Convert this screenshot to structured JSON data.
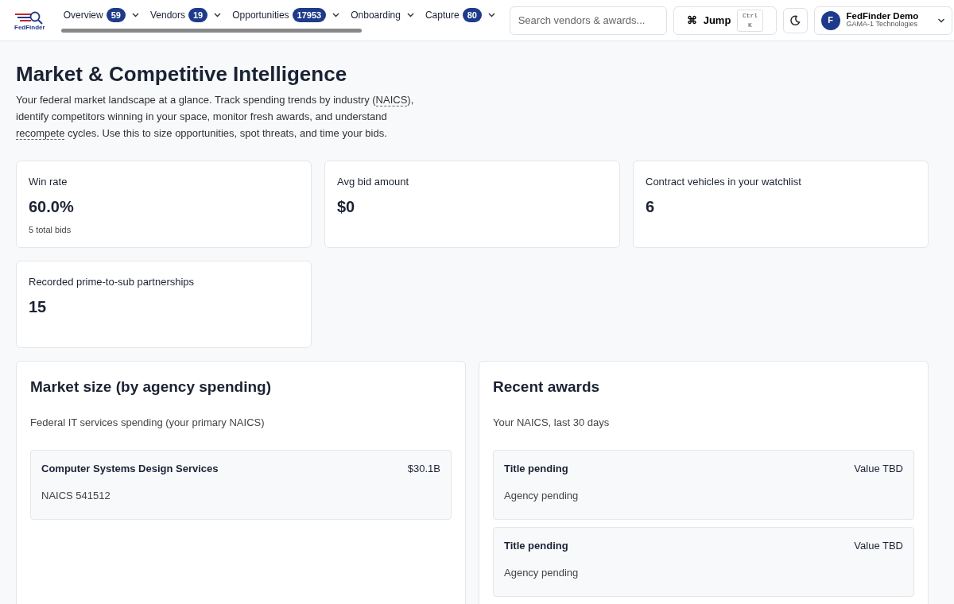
{
  "brand": {
    "name": "FedFinder"
  },
  "nav": [
    {
      "label": "Overview",
      "count": "59"
    },
    {
      "label": "Vendors",
      "count": "19"
    },
    {
      "label": "Opportunities",
      "count": "17953"
    },
    {
      "label": "Onboarding"
    },
    {
      "label": "Capture",
      "count": "80"
    }
  ],
  "search": {
    "placeholder": "Search vendors & awards..."
  },
  "jump": {
    "icon": "⌘",
    "label": "Jump",
    "shortcut": "Ctrl K"
  },
  "user": {
    "initial": "F",
    "name": "FedFinder Demo",
    "org": "GAMA-1 Technologies"
  },
  "page": {
    "title": "Market & Competitive Intelligence",
    "description": [
      {
        "kind": "text",
        "text": "Your federal market landscape at a glance. Track spending trends by industry ("
      },
      {
        "kind": "term",
        "text": "NAICS"
      },
      {
        "kind": "text",
        "text": "), identify competitors winning in your space, monitor fresh awards, and understand "
      },
      {
        "kind": "term",
        "text": "recompete"
      },
      {
        "kind": "text",
        "text": " cycles. Use this to size opportunities, spot threats, and time your bids."
      }
    ]
  },
  "stats": [
    {
      "label": "Win rate",
      "value": "60.0%",
      "note": "5 total bids"
    },
    {
      "label": "Avg bid amount",
      "value": "$0"
    },
    {
      "label": "Contract vehicles in your watchlist",
      "value": "6"
    },
    {
      "label": "Recorded prime-to-sub partnerships",
      "value": "15"
    }
  ],
  "market": {
    "title": "Market size (by agency spending)",
    "subtitle": "Federal IT services spending (your primary NAICS)",
    "items": [
      {
        "name": "Computer Systems Design Services",
        "amount": "$30.1B",
        "code": "NAICS 541512"
      }
    ]
  },
  "awards": {
    "title": "Recent awards",
    "subtitle": "Your NAICS, last 30 days",
    "items": [
      {
        "title": "Title pending",
        "value": "Value TBD",
        "agency": "Agency pending"
      },
      {
        "title": "Title pending",
        "value": "Value TBD",
        "agency": "Agency pending"
      }
    ]
  }
}
